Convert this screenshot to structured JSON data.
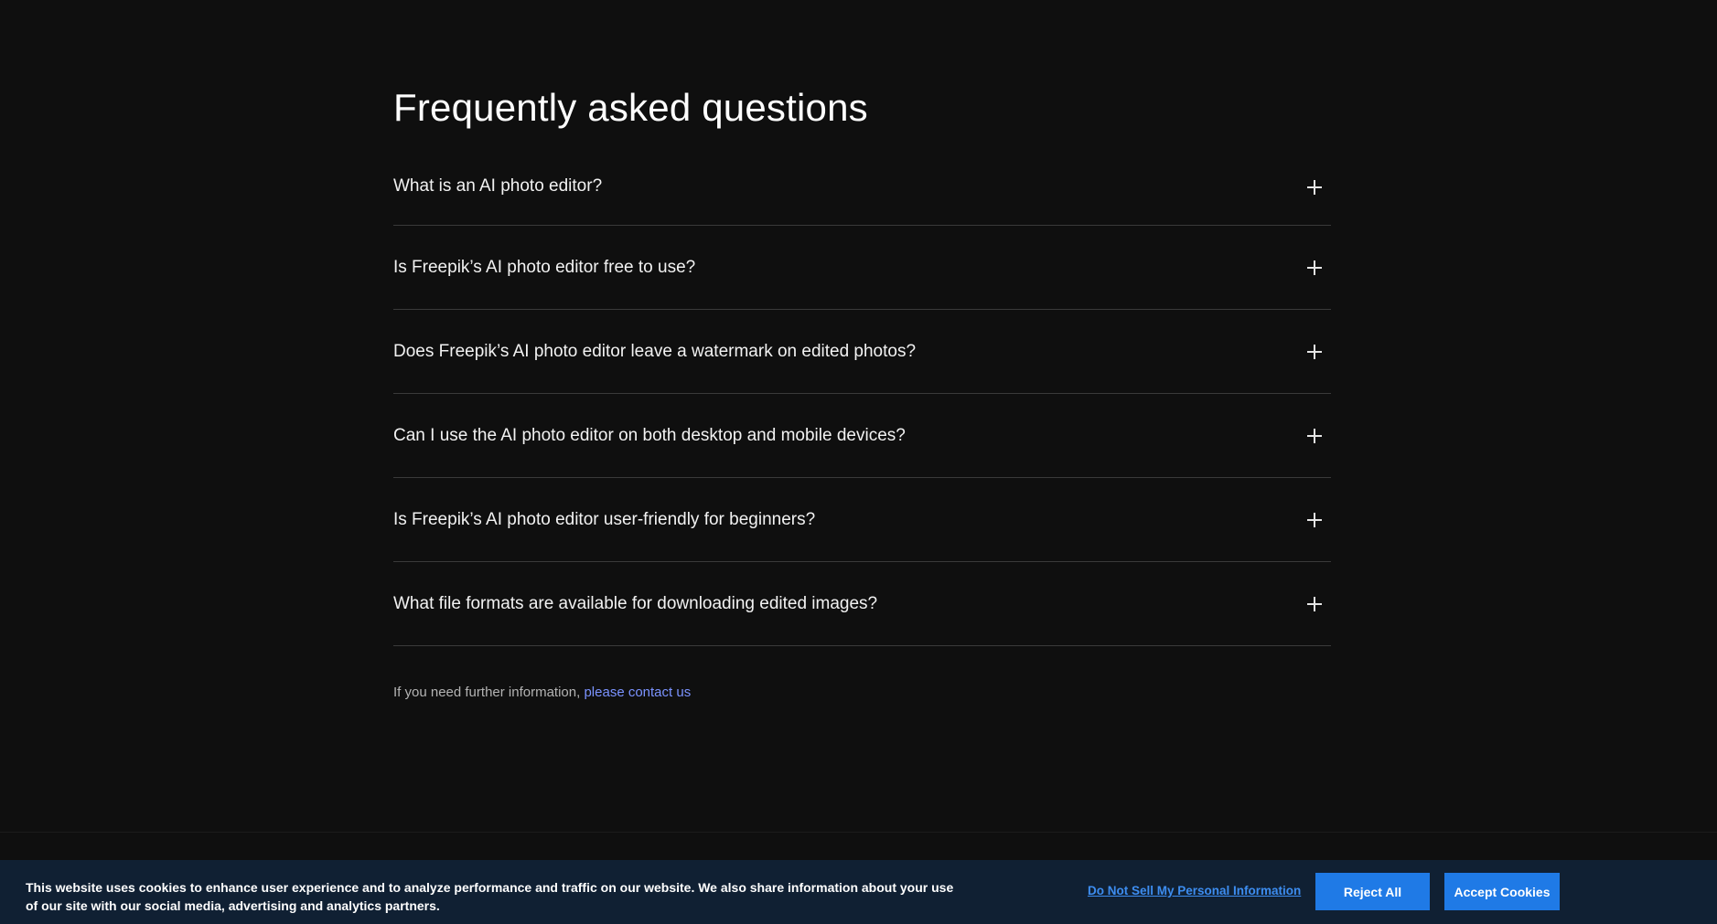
{
  "faq": {
    "title": "Frequently asked questions",
    "items": [
      {
        "question": "What is an AI photo editor?",
        "icon": "plus-icon"
      },
      {
        "question": "Is Freepik’s AI photo editor free to use?",
        "icon": "plus-icon"
      },
      {
        "question": "Does Freepik’s AI photo editor leave a watermark on edited photos?",
        "icon": "plus-icon"
      },
      {
        "question": "Can I use the AI photo editor on both desktop and mobile devices?",
        "icon": "plus-icon"
      },
      {
        "question": "Is Freepik’s AI photo editor user-friendly for beginners?",
        "icon": "plus-icon"
      },
      {
        "question": "What file formats are available for downloading edited images?",
        "icon": "plus-icon"
      }
    ],
    "footer_text": "If you need further information,",
    "footer_link": "please contact us"
  },
  "cookie_banner": {
    "text": "This website uses cookies to enhance user experience and to analyze performance and traffic on our website. We also share information about your use of our site with our social media, advertising and analytics partners.",
    "do_not_sell_label": "Do Not Sell My Personal Information",
    "reject_label": "Reject All",
    "accept_label": "Accept Cookies"
  },
  "colors": {
    "background": "#0f0f0f",
    "banner_background": "#102033",
    "button": "#1f7ae6",
    "link": "#7b93ff"
  }
}
